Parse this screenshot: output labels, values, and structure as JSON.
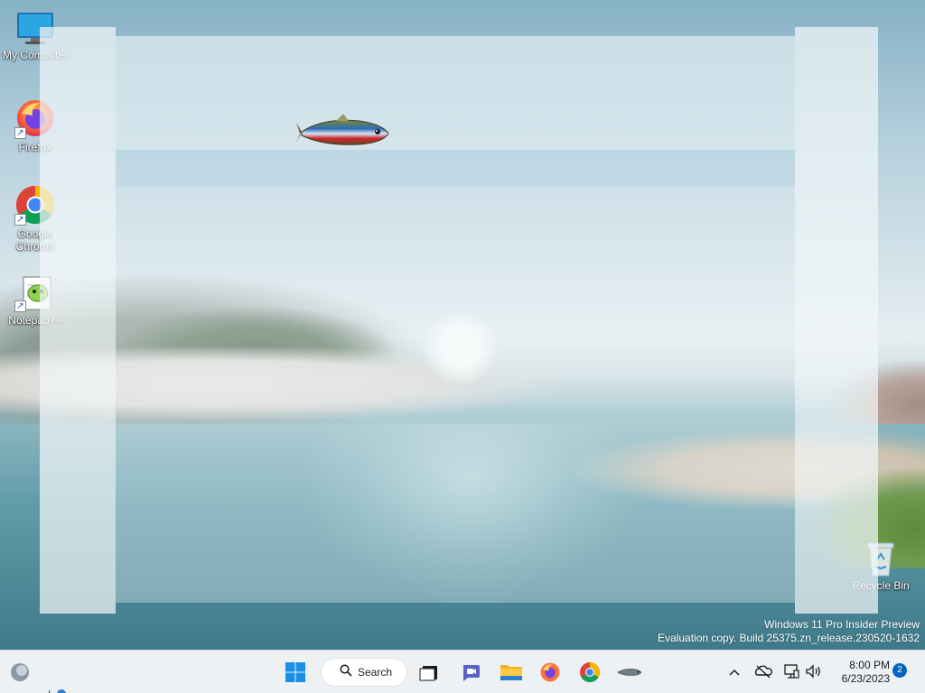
{
  "desktop": {
    "icons": [
      {
        "label": "My Computer",
        "icon": "monitor-icon"
      },
      {
        "label": "Firefox",
        "icon": "firefox-icon"
      },
      {
        "label": "Google Chrome",
        "icon": "chrome-icon"
      },
      {
        "label": "Notepad++",
        "icon": "notepadpp-icon"
      },
      {
        "label": "Recycle Bin",
        "icon": "recycle-bin-icon"
      }
    ],
    "watermark": {
      "line1": "Windows 11 Pro Insider Preview",
      "line2": "Evaluation copy. Build 25375.zn_release.230520-1632"
    }
  },
  "taskbar": {
    "search_label": "Search",
    "apps": [
      "start-icon",
      "search-icon",
      "task-view-icon",
      "chat-icon",
      "file-explorer-icon",
      "firefox-icon",
      "chrome-icon",
      "fish-app-icon"
    ],
    "tray": {
      "icons": [
        "chevron-up-icon",
        "onedrive-icon",
        "network-icon",
        "volume-icon"
      ],
      "time": "8:00 PM",
      "date": "6/23/2023",
      "notification_count": "2"
    }
  },
  "colors": {
    "accent": "#0067c0",
    "taskbar_bg": "#eef1f4"
  }
}
